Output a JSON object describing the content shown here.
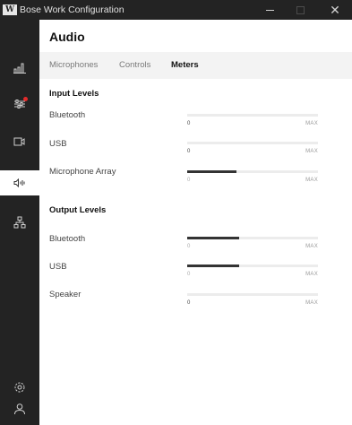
{
  "window": {
    "title": "Bose Work Configuration",
    "logo_text": "W"
  },
  "sidebar": {
    "items": [
      {
        "name": "meters-icon",
        "active": false
      },
      {
        "name": "adjustments-icon",
        "active": false,
        "notification": true
      },
      {
        "name": "camera-icon",
        "active": false
      },
      {
        "name": "audio-icon",
        "active": true
      },
      {
        "name": "network-icon",
        "active": false
      },
      {
        "name": "settings-icon",
        "active": false
      },
      {
        "name": "user-icon",
        "active": false
      }
    ]
  },
  "page": {
    "title": "Audio",
    "tabs": [
      {
        "label": "Microphones",
        "active": false
      },
      {
        "label": "Controls",
        "active": false
      },
      {
        "label": "Meters",
        "active": true
      }
    ]
  },
  "input_levels": {
    "title": "Input Levels",
    "rows": [
      {
        "label": "Bluetooth",
        "min": "0",
        "max": "MAX",
        "level": 0.0
      },
      {
        "label": "USB",
        "min": "0",
        "max": "MAX",
        "level": 0.0
      },
      {
        "label": "Microphone Array",
        "min": "0",
        "max": "MAX",
        "level": 0.38
      }
    ]
  },
  "output_levels": {
    "title": "Output Levels",
    "rows": [
      {
        "label": "Bluetooth",
        "min": "0",
        "max": "MAX",
        "level": 0.4
      },
      {
        "label": "USB",
        "min": "0",
        "max": "MAX",
        "level": 0.4
      },
      {
        "label": "Speaker",
        "min": "0",
        "max": "MAX",
        "level": 0.0
      }
    ]
  },
  "colors": {
    "titlebar": "#232323",
    "sidebar": "#232323",
    "meter_fill": "#333333",
    "meter_track": "#ececec",
    "notification": "#e32b2b",
    "tabbar": "#f3f3f3"
  }
}
